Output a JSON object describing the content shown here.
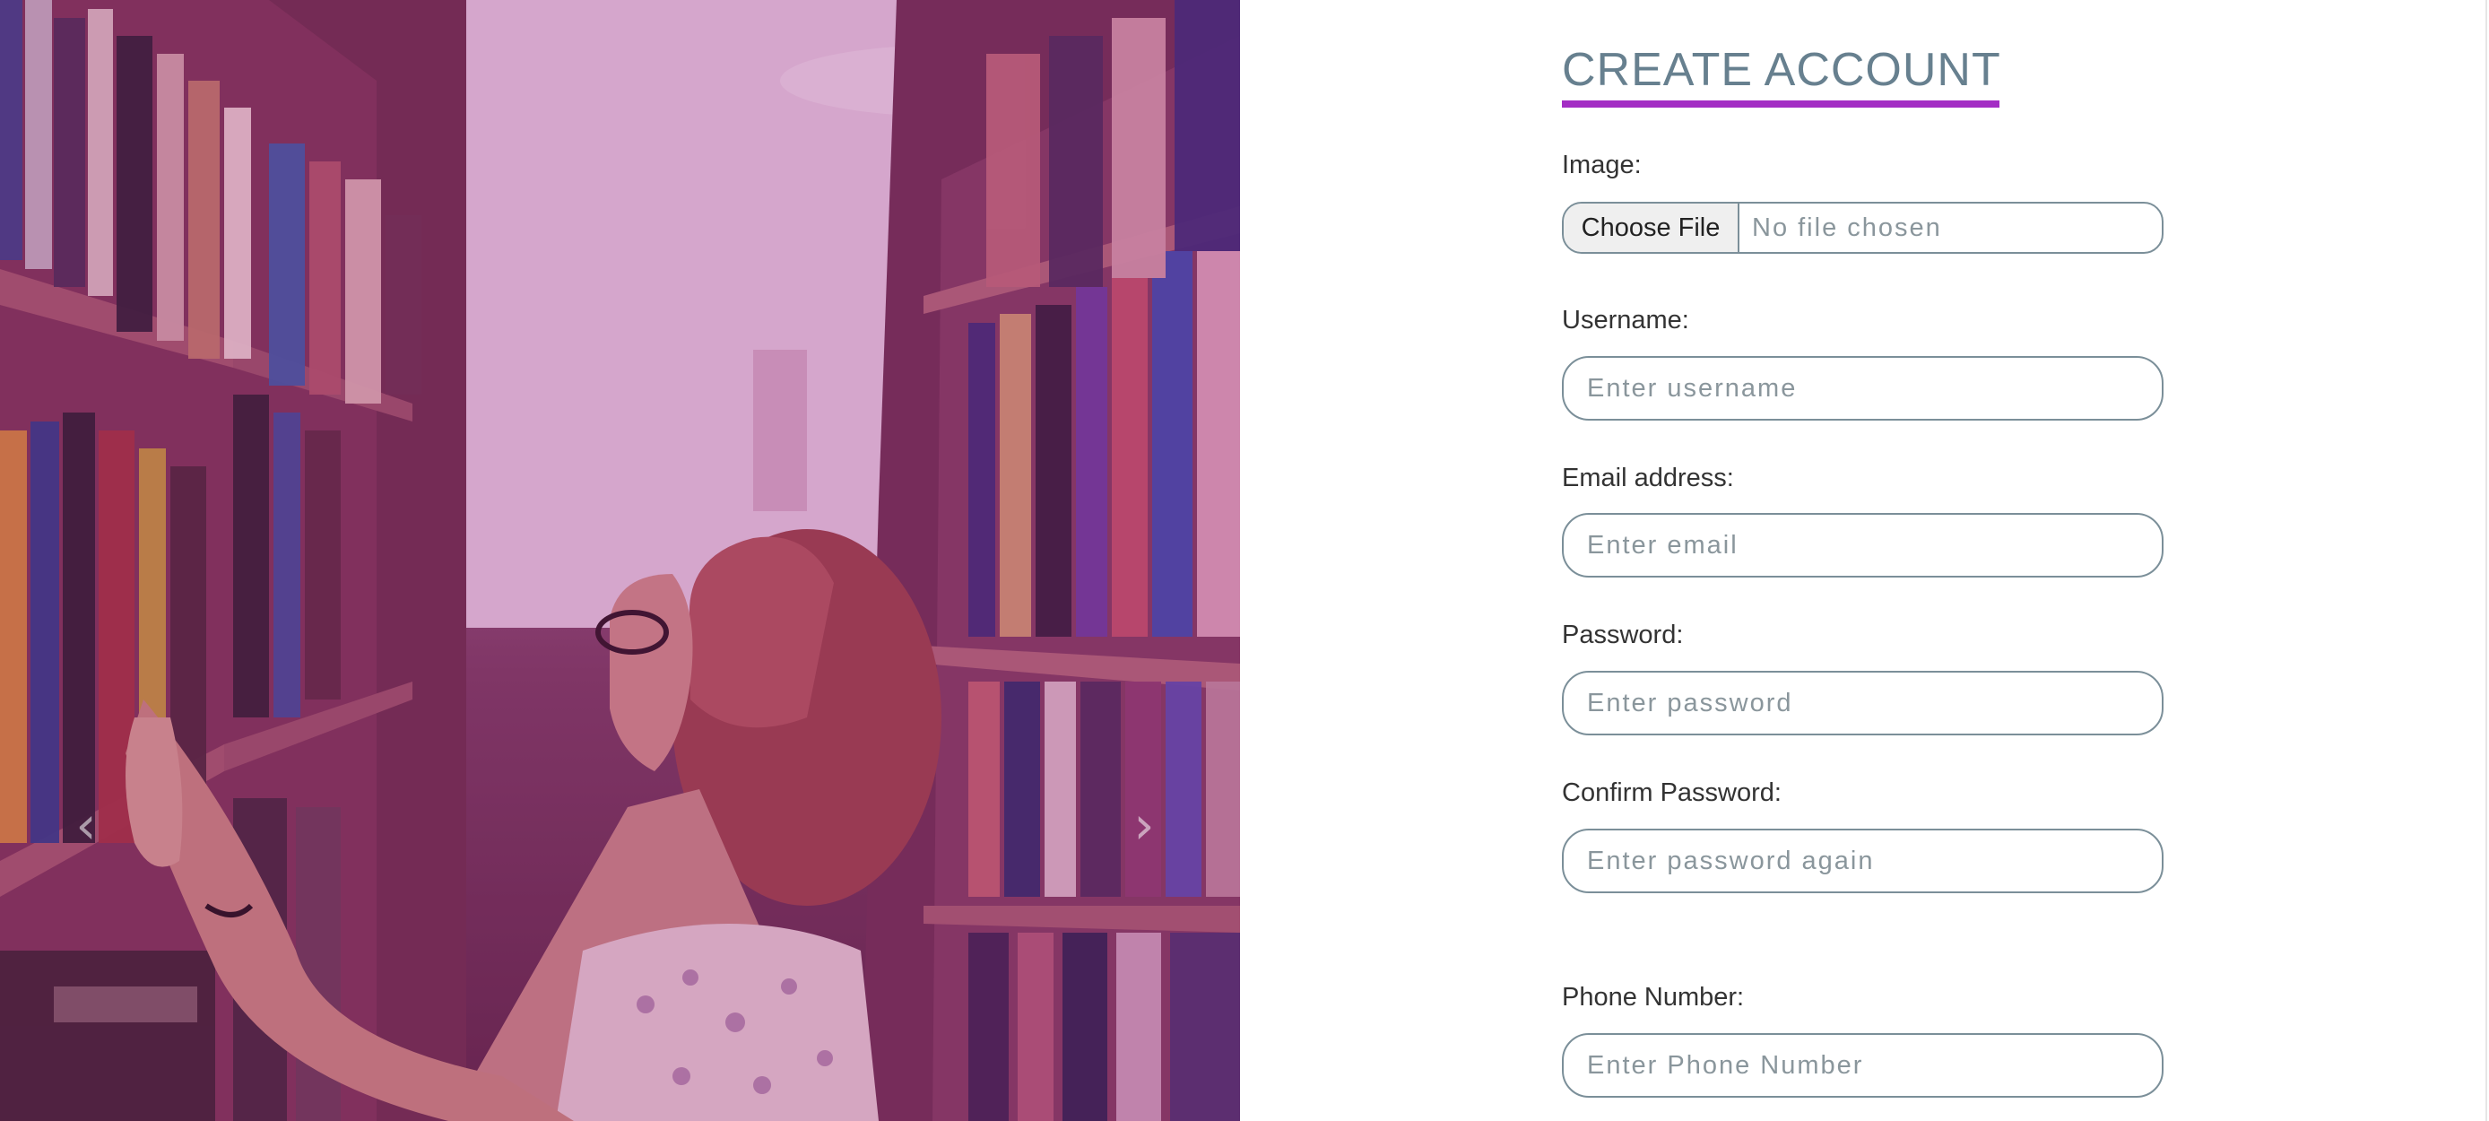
{
  "carousel": {
    "prev_label": "‹",
    "next_label": "›"
  },
  "form": {
    "title": "CREATE ACCOUNT",
    "image_label": "Image:",
    "file_button": "Choose File",
    "file_status": "No file chosen",
    "fields": [
      {
        "label": "Username:",
        "placeholder": "Enter username"
      },
      {
        "label": "Email address:",
        "placeholder": "Enter email"
      },
      {
        "label": "Password:",
        "placeholder": "Enter password"
      },
      {
        "label": "Confirm Password:",
        "placeholder": "Enter password again"
      },
      {
        "label": "Phone Number:",
        "placeholder": "Enter Phone Number"
      }
    ]
  },
  "colors": {
    "accent_underline": "#a32dc4",
    "title": "#67808f",
    "input_border": "#7b8f99"
  }
}
